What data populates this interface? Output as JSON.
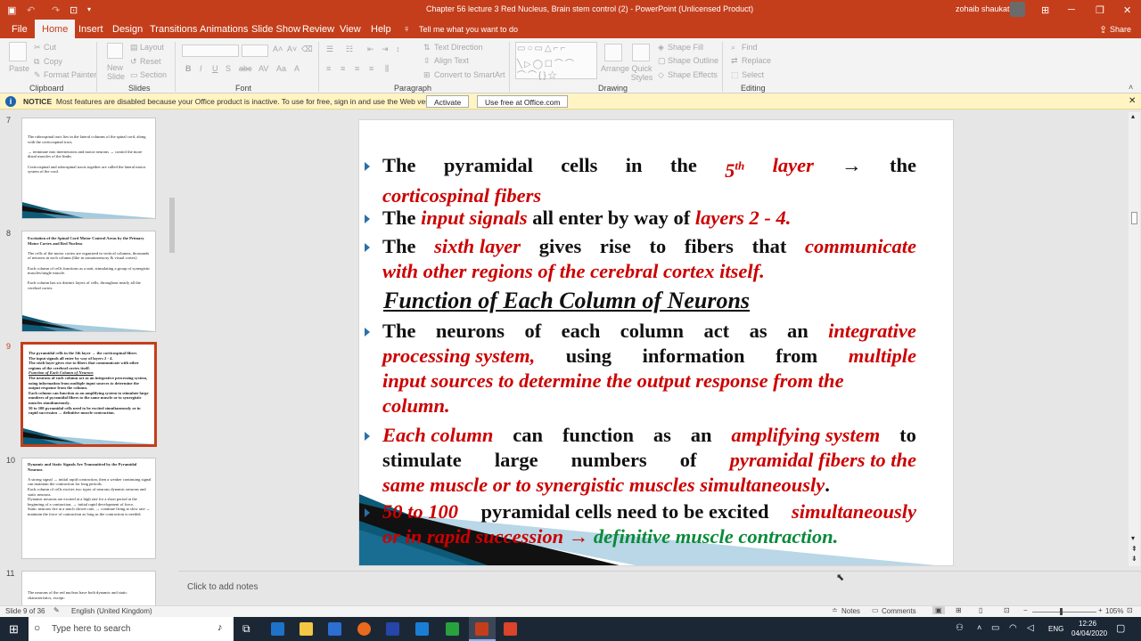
{
  "window": {
    "title": "Chapter 56 lecture 3 Red Nucleus, Brain stem control (2)  -  PowerPoint (Unlicensed Product)",
    "user": "zohaib shaukat"
  },
  "tabs": [
    "File",
    "Home",
    "Insert",
    "Design",
    "Transitions",
    "Animations",
    "Slide Show",
    "Review",
    "View",
    "Help"
  ],
  "active_tab": "Home",
  "tell_me": "Tell me what you want to do",
  "share": "Share",
  "ribbon": {
    "clipboard": {
      "label": "Clipboard",
      "paste": "Paste",
      "cut": "Cut",
      "copy": "Copy",
      "format_painter": "Format Painter"
    },
    "slides": {
      "label": "Slides",
      "new_slide": "New Slide",
      "layout": "Layout",
      "reset": "Reset",
      "section": "Section"
    },
    "font": {
      "label": "Font"
    },
    "paragraph": {
      "label": "Paragraph",
      "text_direction": "Text Direction",
      "align_text": "Align Text",
      "convert": "Convert to SmartArt"
    },
    "drawing": {
      "label": "Drawing",
      "arrange": "Arrange",
      "quick_styles": "Quick Styles",
      "shape_fill": "Shape Fill",
      "shape_outline": "Shape Outline",
      "shape_effects": "Shape Effects"
    },
    "editing": {
      "label": "Editing",
      "find": "Find",
      "replace": "Replace",
      "select": "Select"
    }
  },
  "notice": {
    "label": "NOTICE",
    "text": "Most features are disabled because your Office product is inactive. To use for free, sign in and use the Web version.",
    "activate": "Activate",
    "web": "Use free at Office.com"
  },
  "thumbnails": [
    {
      "num": "7",
      "lines": [
        "The rubrospinal tract lies in the lateral columns of the spinal cord, along with the corticospinal tract,",
        "→ terminate into interneurons and motor neurons → control the more distal muscles of the limbs",
        "Corticospinal and rubrospinal tracts together are called the lateral motor system of the cord."
      ]
    },
    {
      "num": "8",
      "lines": [
        "Excitation of the Spinal Cord Motor Control Areas by the Primary Motor Cortex and Red Nucleus",
        "The cells of the motor cortex are organized in vertical columns, thousands of neurons in each column (like in somatosensory & visual cortex)",
        "Each column of cells functions as a unit, stimulating a group of synergistic muscles/single muscle.",
        "Each column has six distinct layers of cells, throughout nearly all the cerebral cortex."
      ]
    },
    {
      "num": "9",
      "lines": [
        "The pyramidal cells in the 5th layer → the corticospinal fibers",
        "The input signals all enter by way of layers 2 - 4.",
        "The sixth layer gives rise to fibers that communicate with other regions of the cerebral cortex itself.",
        "Function of Each Column of Neurons",
        "The neurons of each column act as an integrative processing system, using information from multiple input sources to determine the output response from the column.",
        "Each column can function as an amplifying system to stimulate large numbers of pyramidal fibers to the same muscle or to synergistic muscles simultaneously.",
        "50 to 100 pyramidal cells need to be excited simultaneously or in rapid succession → definitive muscle contraction."
      ]
    },
    {
      "num": "10",
      "lines": [
        "Dynamic and Static Signals Are Transmitted by the Pyramidal Neurons",
        "A strong signal → initial rapid contraction, then a weaker continuing signal can maintain the contraction for long periods.",
        "Each column of cells excites two types of neurons dynamic neurons and static neurons.",
        "Dynamic neurons are excited at a high rate for a short period at the beginning of a contraction, → initial rapid development of force.",
        "Static neurons fire at a much slower rate, → continue firing at slow rate → maintain the force of contraction as long as the contraction is needed."
      ]
    },
    {
      "num": "11",
      "lines": [
        "The neurons of the red nucleus have both dynamic and static characteristics, except:"
      ]
    }
  ],
  "slide": {
    "b1_words": [
      "The",
      "pyramidal",
      "cells",
      "in",
      "the",
      "5th",
      "layer",
      "→",
      "the"
    ],
    "b1_line2": "corticospinal fibers",
    "b2": {
      "a": "The",
      "b": "input signals",
      "c": "all enter by way of",
      "d": "layers 2 - 4."
    },
    "b3_line1": [
      "The",
      "sixth layer",
      "gives",
      "rise",
      "to",
      "fibers",
      "that",
      "communicate"
    ],
    "b3_line2": "with other regions of the cerebral cortex itself.",
    "heading": "Function of Each Column of Neurons",
    "b4_l1": [
      "The",
      "neurons",
      "of",
      "each",
      "column",
      "act",
      "as",
      "an",
      "integrative"
    ],
    "b4_l2": [
      "processing system,",
      "using",
      "information",
      "from",
      "multiple"
    ],
    "b4_l3": "input sources to determine the output response from the",
    "b4_l4": "column.",
    "b5_l1": [
      "Each column",
      "can",
      "function",
      "as",
      "an",
      "amplifying system",
      "to"
    ],
    "b5_l2": [
      "stimulate",
      "large",
      "numbers",
      "of",
      "pyramidal fibers to the"
    ],
    "b5_l3": "same muscle or to synergistic muscles simultaneously",
    "b6_l1": {
      "a": "50 to 100",
      "b": "pyramidal cells need to be excited",
      "c": "simultaneously"
    },
    "b6_l2": {
      "a": "or in rapid succession",
      "arrow": "→",
      "b": "definitive muscle contraction."
    }
  },
  "notes_placeholder": "Click to add notes",
  "status": {
    "slide": "Slide 9 of 36",
    "language": "English (United Kingdom)",
    "notes": "Notes",
    "comments": "Comments",
    "zoom": "105%"
  },
  "taskbar": {
    "search": "Type here to search",
    "time": "12:26",
    "date": "04/04/2020",
    "lang": "ENG"
  }
}
